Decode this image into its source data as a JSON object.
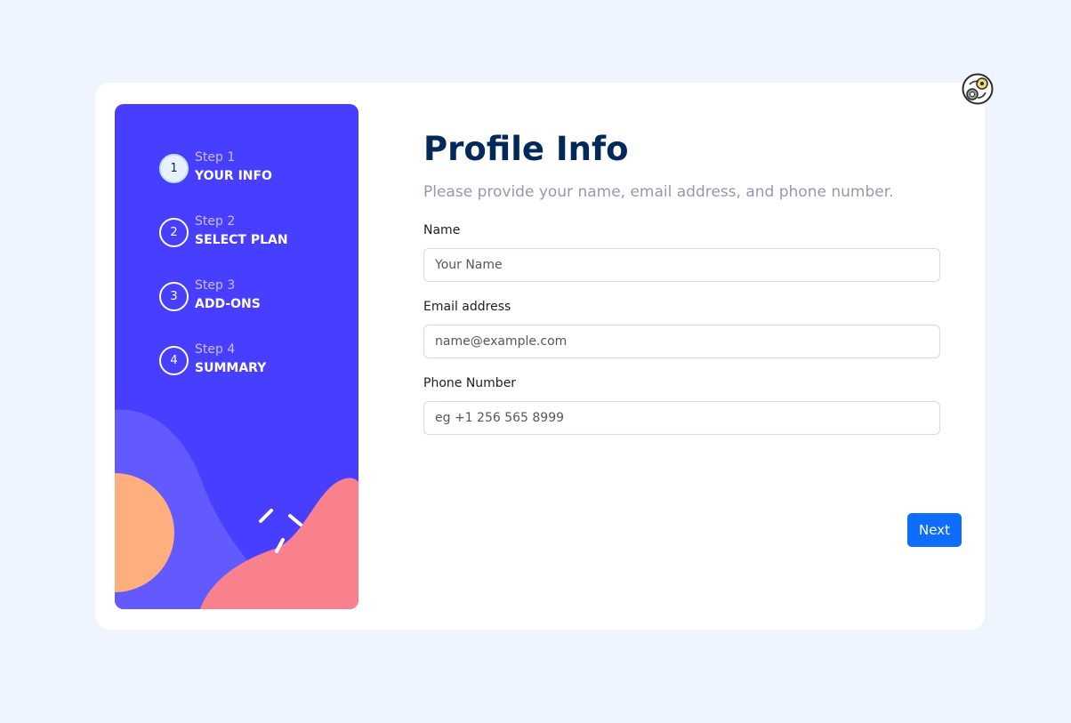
{
  "sidebar": {
    "steps": [
      {
        "number": "1",
        "label": "Step 1",
        "title": "YOUR INFO",
        "active": true
      },
      {
        "number": "2",
        "label": "Step 2",
        "title": "SELECT PLAN",
        "active": false
      },
      {
        "number": "3",
        "label": "Step 3",
        "title": "ADD-ONS",
        "active": false
      },
      {
        "number": "4",
        "label": "Step 4",
        "title": "SUMMARY",
        "active": false
      }
    ]
  },
  "main": {
    "title": "Profile Info",
    "subtitle": "Please provide your name, email address, and phone number.",
    "fields": {
      "name": {
        "label": "Name",
        "value": "",
        "placeholder": "Your Name"
      },
      "email": {
        "label": "Email address",
        "value": "",
        "placeholder": "name@example.com"
      },
      "phone": {
        "label": "Phone Number",
        "value": "",
        "placeholder": "eg +1 256 565 8999"
      }
    },
    "next_label": "Next"
  },
  "colors": {
    "sidebar_bg": "#483eff",
    "accent_button": "#0d6efd",
    "title_text": "#02295a",
    "subtitle_text": "#9699ab",
    "page_bg": "#eff5ff",
    "blob_light_purple": "#6259ff",
    "blob_orange": "#ffaf7e",
    "blob_pink": "#f9818e"
  },
  "icons": {
    "corner_widget": "extension-badge-icon"
  }
}
